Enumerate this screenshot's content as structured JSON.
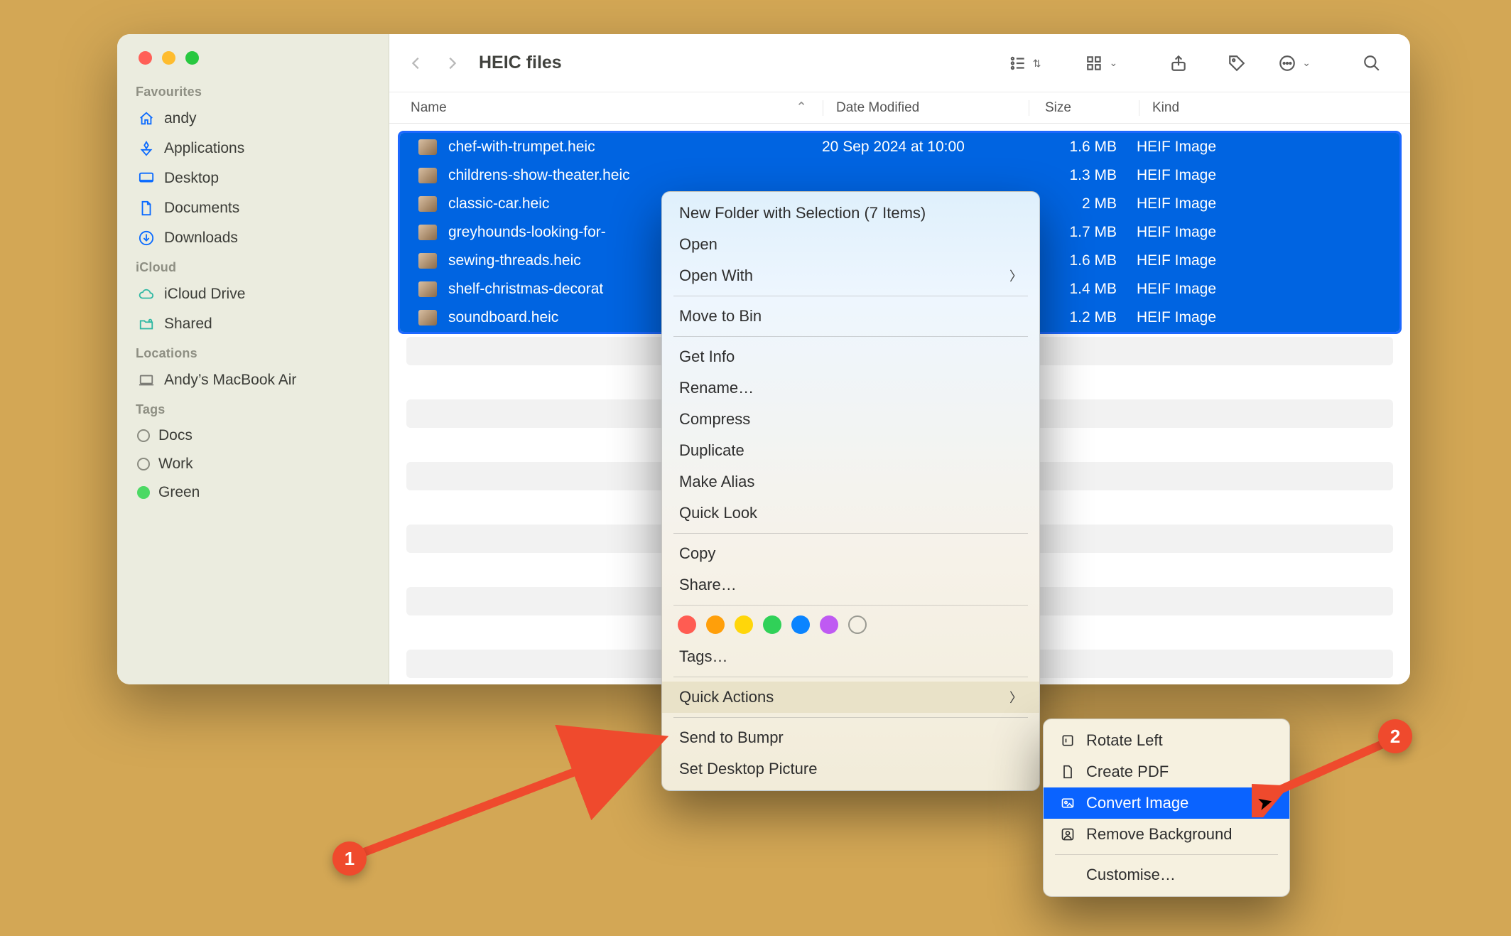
{
  "window": {
    "title": "HEIC files"
  },
  "columns": {
    "name": "Name",
    "date": "Date Modified",
    "size": "Size",
    "kind": "Kind"
  },
  "sidebar": {
    "sections": {
      "favourites": "Favourites",
      "icloud": "iCloud",
      "locations": "Locations",
      "tags": "Tags"
    },
    "favourites": [
      {
        "label": "andy",
        "icon": "house-icon"
      },
      {
        "label": "Applications",
        "icon": "app-grid-icon"
      },
      {
        "label": "Desktop",
        "icon": "desktop-icon"
      },
      {
        "label": "Documents",
        "icon": "document-icon"
      },
      {
        "label": "Downloads",
        "icon": "download-icon"
      }
    ],
    "icloud": [
      {
        "label": "iCloud Drive",
        "icon": "cloud-icon"
      },
      {
        "label": "Shared",
        "icon": "shared-folder-icon"
      }
    ],
    "locations": [
      {
        "label": "Andy’s MacBook Air",
        "icon": "laptop-icon"
      }
    ],
    "tags": [
      {
        "label": "Docs",
        "color": "none"
      },
      {
        "label": "Work",
        "color": "none"
      },
      {
        "label": "Green",
        "color": "green"
      }
    ]
  },
  "files": [
    {
      "name": "chef-with-trumpet.heic",
      "date": "20 Sep 2024 at 10:00",
      "size": "1.6 MB",
      "kind": "HEIF Image"
    },
    {
      "name": "childrens-show-theater.heic",
      "date": "",
      "size": "1.3 MB",
      "kind": "HEIF Image"
    },
    {
      "name": "classic-car.heic",
      "date": "",
      "size": "2 MB",
      "kind": "HEIF Image"
    },
    {
      "name": "greyhounds-looking-for-",
      "date": "",
      "size": "1.7 MB",
      "kind": "HEIF Image"
    },
    {
      "name": "sewing-threads.heic",
      "date": "",
      "size": "1.6 MB",
      "kind": "HEIF Image"
    },
    {
      "name": "shelf-christmas-decorat",
      "date": "",
      "size": "1.4 MB",
      "kind": "HEIF Image"
    },
    {
      "name": "soundboard.heic",
      "date": "",
      "size": "1.2 MB",
      "kind": "HEIF Image"
    }
  ],
  "context_menu": {
    "new_folder": "New Folder with Selection (7 Items)",
    "open": "Open",
    "open_with": "Open With",
    "move_to_bin": "Move to Bin",
    "get_info": "Get Info",
    "rename": "Rename…",
    "compress": "Compress",
    "duplicate": "Duplicate",
    "make_alias": "Make Alias",
    "quick_look": "Quick Look",
    "copy": "Copy",
    "share": "Share…",
    "tags": "Tags…",
    "quick_actions": "Quick Actions",
    "send_to_bumpr": "Send to Bumpr",
    "set_desktop": "Set Desktop Picture"
  },
  "submenu": {
    "rotate_left": "Rotate Left",
    "create_pdf": "Create PDF",
    "convert_image": "Convert Image",
    "remove_background": "Remove Background",
    "customise": "Customise…"
  },
  "annotations": {
    "badge1": "1",
    "badge2": "2"
  }
}
